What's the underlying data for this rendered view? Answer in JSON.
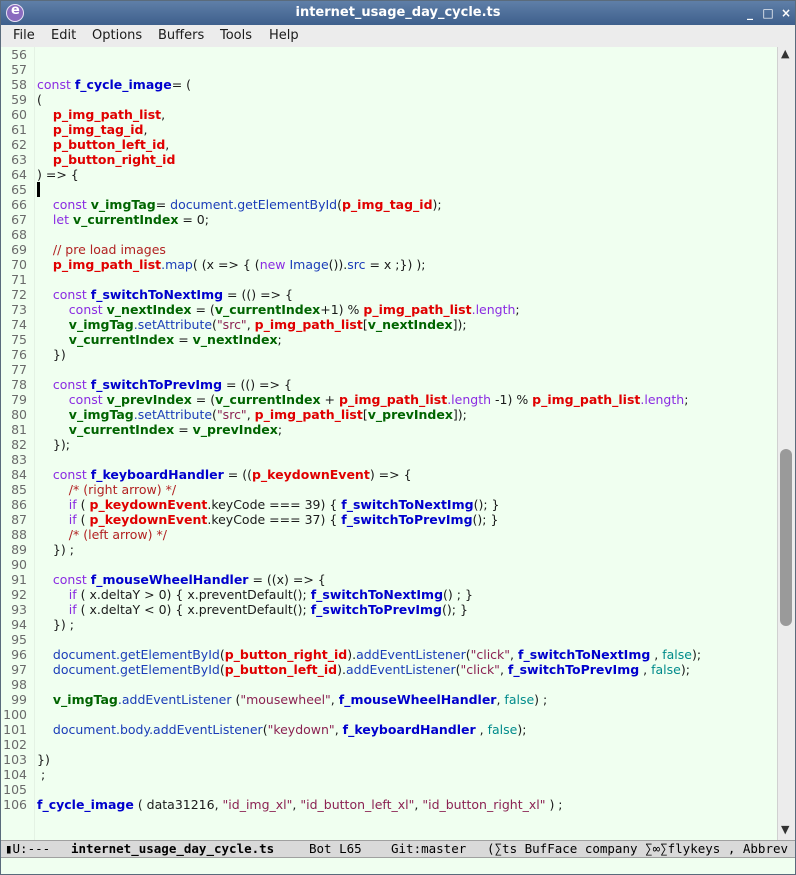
{
  "window": {
    "title": "internet_usage_day_cycle.ts",
    "app_icon": "emacs-icon",
    "controls": {
      "minimize": "_",
      "maximize": "□",
      "close": "×"
    }
  },
  "menubar": {
    "items": [
      "File",
      "Edit",
      "Options",
      "Buffers",
      "Tools",
      "Help"
    ]
  },
  "editor": {
    "line_numbers": [
      "56",
      "57",
      "58",
      "59",
      "60",
      "61",
      "62",
      "63",
      "64",
      "65",
      "66",
      "67",
      "68",
      "69",
      "70",
      "71",
      "72",
      "73",
      "74",
      "75",
      "76",
      "77",
      "78",
      "79",
      "80",
      "81",
      "82",
      "83",
      "84",
      "85",
      "86",
      "87",
      "88",
      "89",
      "90",
      "91",
      "92",
      "93",
      "94",
      "95",
      "96",
      "97",
      "98",
      "99",
      "100",
      "101",
      "102",
      "103",
      "104",
      "105",
      "106"
    ],
    "lines": [
      [],
      [],
      [
        [
          "kw",
          "const "
        ],
        [
          "fn",
          "f_cycle_image"
        ],
        [
          "",
          "= ("
        ]
      ],
      [
        [
          "",
          "("
        ]
      ],
      [
        [
          "",
          "    "
        ],
        [
          "pr",
          "p_img_path_list"
        ],
        [
          "",
          ","
        ]
      ],
      [
        [
          "",
          "    "
        ],
        [
          "pr",
          "p_img_tag_id"
        ],
        [
          "",
          ","
        ]
      ],
      [
        [
          "",
          "    "
        ],
        [
          "pr",
          "p_button_left_id"
        ],
        [
          "",
          ","
        ]
      ],
      [
        [
          "",
          "    "
        ],
        [
          "pr",
          "p_button_right_id"
        ]
      ],
      [
        [
          "",
          ") => {"
        ]
      ],
      [],
      [
        [
          "",
          "    "
        ],
        [
          "kw",
          "const "
        ],
        [
          "vr",
          "v_imgTag"
        ],
        [
          "",
          "",
          " "
        ],
        [
          "",
          ""
        ],
        [
          "",
          "= "
        ],
        [
          "bi",
          "document.getElementById"
        ],
        [
          "",
          "("
        ],
        [
          "pr",
          "p_img_tag_id"
        ],
        [
          "",
          "); "
        ]
      ],
      [
        [
          "",
          "    "
        ],
        [
          "kw",
          "let "
        ],
        [
          "vr",
          "v_currentIndex"
        ],
        [
          "",
          " = 0;"
        ]
      ],
      [],
      [
        [
          "",
          "    "
        ],
        [
          "cm",
          "// pre load images"
        ]
      ],
      [
        [
          "",
          "    "
        ],
        [
          "pr",
          "p_img_path_list"
        ],
        [
          "bi",
          ".map"
        ],
        [
          "",
          "( (x => { ("
        ],
        [
          "kw",
          "new "
        ],
        [
          "bi",
          "Image"
        ],
        [
          "",
          "())."
        ],
        [
          "bi",
          "src"
        ],
        [
          "",
          " = x ;}) );"
        ]
      ],
      [],
      [
        [
          "",
          "    "
        ],
        [
          "kw",
          "const "
        ],
        [
          "fn",
          "f_switchToNextImg"
        ],
        [
          "",
          " = (() => {"
        ]
      ],
      [
        [
          "",
          "        "
        ],
        [
          "kw",
          "const "
        ],
        [
          "vr",
          "v_nextIndex"
        ],
        [
          "",
          " = ("
        ],
        [
          "vr",
          "v_currentIndex"
        ],
        [
          "",
          "+1) % "
        ],
        [
          "pr",
          "p_img_path_list"
        ],
        [
          "kw",
          ".length"
        ],
        [
          "",
          ";"
        ]
      ],
      [
        [
          "",
          "        "
        ],
        [
          "vr",
          "v_imgTag"
        ],
        [
          "bi",
          ".setAttribute"
        ],
        [
          "",
          "("
        ],
        [
          "st",
          "\"src\""
        ],
        [
          "",
          ", "
        ],
        [
          "pr",
          "p_img_path_list"
        ],
        [
          "",
          "["
        ],
        [
          "vr",
          "v_nextIndex"
        ],
        [
          "",
          "]);"
        ]
      ],
      [
        [
          "",
          "        "
        ],
        [
          "vr",
          "v_currentIndex"
        ],
        [
          "",
          " = "
        ],
        [
          "vr",
          "v_nextIndex"
        ],
        [
          "",
          ";"
        ]
      ],
      [
        [
          "",
          "    })"
        ]
      ],
      [],
      [
        [
          "",
          "    "
        ],
        [
          "kw",
          "const "
        ],
        [
          "fn",
          "f_switchToPrevImg"
        ],
        [
          "",
          " = (() => {"
        ]
      ],
      [
        [
          "",
          "        "
        ],
        [
          "kw",
          "const "
        ],
        [
          "vr",
          "v_prevIndex"
        ],
        [
          "",
          " = ("
        ],
        [
          "vr",
          "v_currentIndex"
        ],
        [
          "",
          " + "
        ],
        [
          "pr",
          "p_img_path_list"
        ],
        [
          "kw",
          ".length"
        ],
        [
          "",
          " -1) % "
        ],
        [
          "pr",
          "p_img_path_list"
        ],
        [
          "kw",
          ".length"
        ],
        [
          "",
          ";"
        ]
      ],
      [
        [
          "",
          "        "
        ],
        [
          "vr",
          "v_imgTag"
        ],
        [
          "bi",
          ".setAttribute"
        ],
        [
          "",
          "("
        ],
        [
          "st",
          "\"src\""
        ],
        [
          "",
          ", "
        ],
        [
          "pr",
          "p_img_path_list"
        ],
        [
          "",
          "["
        ],
        [
          "vr",
          "v_prevIndex"
        ],
        [
          "",
          "]);"
        ]
      ],
      [
        [
          "",
          "        "
        ],
        [
          "vr",
          "v_currentIndex"
        ],
        [
          "",
          " = "
        ],
        [
          "vr",
          "v_prevIndex"
        ],
        [
          "",
          ";"
        ]
      ],
      [
        [
          "",
          "    });"
        ]
      ],
      [],
      [
        [
          "",
          "    "
        ],
        [
          "kw",
          "const "
        ],
        [
          "fn",
          "f_keyboardHandler"
        ],
        [
          "",
          " = (("
        ],
        [
          "pr",
          "p_keydownEvent"
        ],
        [
          "",
          ") => {"
        ]
      ],
      [
        [
          "",
          "        "
        ],
        [
          "cm",
          "/* (right arrow) */"
        ]
      ],
      [
        [
          "",
          "        "
        ],
        [
          "kw",
          "if "
        ],
        [
          "",
          "( "
        ],
        [
          "pr",
          "p_keydownEvent"
        ],
        [
          "",
          ".keyCode === 39) { "
        ],
        [
          "fn",
          "f_switchToNextImg"
        ],
        [
          "",
          "(); }"
        ]
      ],
      [
        [
          "",
          "        "
        ],
        [
          "kw",
          "if "
        ],
        [
          "",
          "( "
        ],
        [
          "pr",
          "p_keydownEvent"
        ],
        [
          "",
          ".keyCode === 37) { "
        ],
        [
          "fn",
          "f_switchToPrevImg"
        ],
        [
          "",
          "(); }"
        ]
      ],
      [
        [
          "",
          "        "
        ],
        [
          "cm",
          "/* (left arrow) */"
        ]
      ],
      [
        [
          "",
          "    }) ;"
        ]
      ],
      [],
      [
        [
          "",
          "    "
        ],
        [
          "kw",
          "const "
        ],
        [
          "fn",
          "f_mouseWheelHandler"
        ],
        [
          "",
          " = ((x) => {"
        ]
      ],
      [
        [
          "",
          "        "
        ],
        [
          "kw",
          "if "
        ],
        [
          "",
          "( x.deltaY > 0) { x.preventDefault(); "
        ],
        [
          "fn",
          "f_switchToNextImg"
        ],
        [
          "",
          "() ; }"
        ]
      ],
      [
        [
          "",
          "        "
        ],
        [
          "kw",
          "if "
        ],
        [
          "",
          "( x.deltaY < 0) { x.preventDefault(); "
        ],
        [
          "fn",
          "f_switchToPrevImg"
        ],
        [
          "",
          "(); }"
        ]
      ],
      [
        [
          "",
          "    }) ;"
        ]
      ],
      [],
      [
        [
          "",
          "    "
        ],
        [
          "bi",
          "document.getElementById"
        ],
        [
          "",
          "("
        ],
        [
          "pr",
          "p_button_right_id"
        ],
        [
          "",
          ")."
        ],
        [
          "bi",
          "addEventListener"
        ],
        [
          "",
          "("
        ],
        [
          "st",
          "\"click\""
        ],
        [
          "",
          ", "
        ],
        [
          "fn",
          "f_switchToNextImg"
        ],
        [
          "",
          " , "
        ],
        [
          "bl",
          "false"
        ],
        [
          "",
          ");"
        ]
      ],
      [
        [
          "",
          "    "
        ],
        [
          "bi",
          "document.getElementById"
        ],
        [
          "",
          "("
        ],
        [
          "pr",
          "p_button_left_id"
        ],
        [
          "",
          ")."
        ],
        [
          "bi",
          "addEventListener"
        ],
        [
          "",
          "("
        ],
        [
          "st",
          "\"click\""
        ],
        [
          "",
          ", "
        ],
        [
          "fn",
          "f_switchToPrevImg"
        ],
        [
          "",
          " , "
        ],
        [
          "bl",
          "false"
        ],
        [
          "",
          ");"
        ]
      ],
      [],
      [
        [
          "",
          "    "
        ],
        [
          "vr",
          "v_imgTag"
        ],
        [
          "bi",
          ".addEventListener"
        ],
        [
          "",
          " ("
        ],
        [
          "st",
          "\"mousewheel\""
        ],
        [
          "",
          ", "
        ],
        [
          "fn",
          "f_mouseWheelHandler"
        ],
        [
          "",
          ", "
        ],
        [
          "bl",
          "false"
        ],
        [
          "",
          ") ;"
        ]
      ],
      [],
      [
        [
          "",
          "    "
        ],
        [
          "bi",
          "document.body.addEventListener"
        ],
        [
          "",
          "("
        ],
        [
          "st",
          "\"keydown\""
        ],
        [
          "",
          ", "
        ],
        [
          "fn",
          "f_keyboardHandler"
        ],
        [
          "",
          " , "
        ],
        [
          "bl",
          "false"
        ],
        [
          "",
          ");"
        ]
      ],
      [],
      [
        [
          "",
          "})"
        ]
      ],
      [
        [
          "",
          " ;"
        ]
      ],
      [],
      [
        [
          "fn",
          "f_cycle_image"
        ],
        [
          "",
          " ( data31216, "
        ],
        [
          "st",
          "\"id_img_xl\""
        ],
        [
          "",
          ", "
        ],
        [
          "st",
          "\"id_button_left_xl\""
        ],
        [
          "",
          ", "
        ],
        [
          "st",
          "\"id_button_right_xl\""
        ],
        [
          "",
          " ) ;"
        ]
      ]
    ]
  },
  "modeline": {
    "state": "▮U:---",
    "buffer": "internet_usage_day_cycle.ts",
    "position": "Bot L65",
    "vc": "Git:master",
    "modes": "(∑ts BufFace company ∑∞∑flykeys , Abbrev"
  },
  "colors": {
    "keyword": "#8a2be2",
    "function": "#0000cd",
    "parameter": "#e00000",
    "variable": "#006400",
    "builtin": "#1a3cb8",
    "string": "#8b2252",
    "comment": "#b22222",
    "constant": "#008b8b",
    "editor_background": "#f0fff0"
  }
}
